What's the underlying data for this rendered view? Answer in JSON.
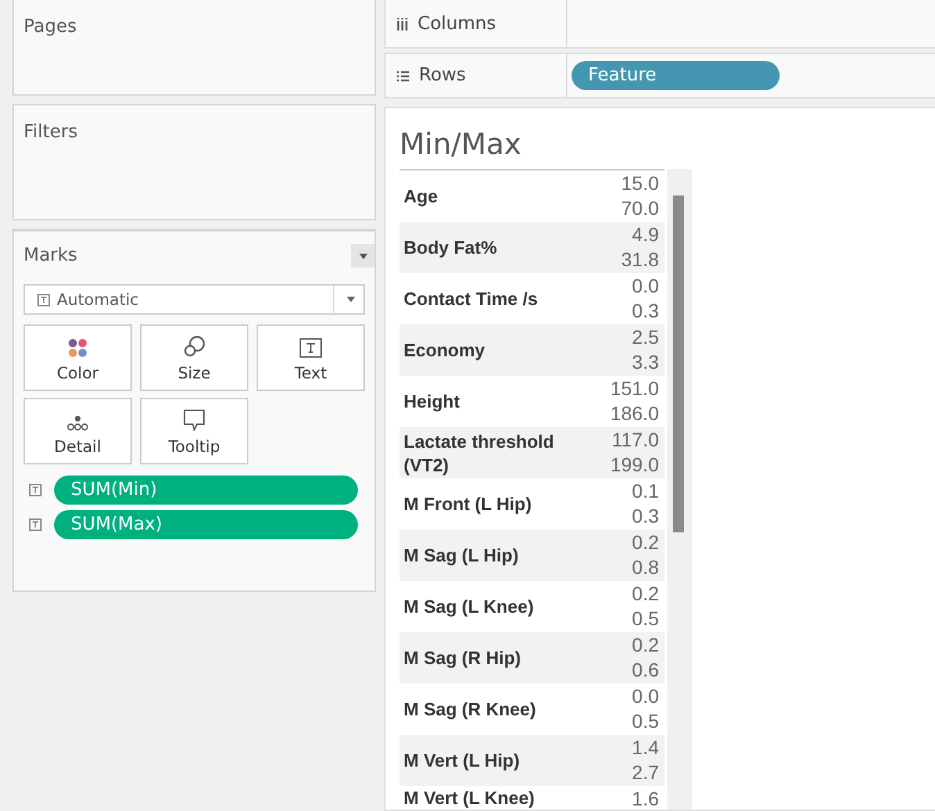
{
  "left_panel": {
    "pages": {
      "title": "Pages"
    },
    "filters": {
      "title": "Filters"
    },
    "marks": {
      "title": "Marks",
      "mark_type": "Automatic",
      "cards": [
        {
          "kind": "color",
          "label": "Color"
        },
        {
          "kind": "size",
          "label": "Size"
        },
        {
          "kind": "text",
          "label": "Text"
        },
        {
          "kind": "detail",
          "label": "Detail"
        },
        {
          "kind": "tooltip",
          "label": "Tooltip"
        }
      ],
      "pills": [
        {
          "label": "SUM(Min)"
        },
        {
          "label": "SUM(Max)"
        }
      ]
    }
  },
  "shelves": {
    "columns": {
      "label": "Columns"
    },
    "rows": {
      "label": "Rows",
      "pills": [
        {
          "label": "Feature"
        }
      ]
    }
  },
  "view": {
    "title": "Min/Max",
    "rows": [
      {
        "feature": "Age",
        "values": [
          "15.0",
          "70.0"
        ]
      },
      {
        "feature": "Body Fat%",
        "values": [
          "4.9",
          "31.8"
        ]
      },
      {
        "feature": "Contact Time /s",
        "values": [
          "0.0",
          "0.3"
        ]
      },
      {
        "feature": "Economy",
        "values": [
          "2.5",
          "3.3"
        ]
      },
      {
        "feature": "Height",
        "values": [
          "151.0",
          "186.0"
        ]
      },
      {
        "feature": "Lactate threshold (VT2)",
        "values": [
          "117.0",
          "199.0"
        ]
      },
      {
        "feature": "M Front (L Hip)",
        "values": [
          "0.1",
          "0.3"
        ]
      },
      {
        "feature": "M Sag (L Hip)",
        "values": [
          "0.2",
          "0.8"
        ]
      },
      {
        "feature": "M Sag (L Knee)",
        "values": [
          "0.2",
          "0.5"
        ]
      },
      {
        "feature": "M Sag (R Hip)",
        "values": [
          "0.2",
          "0.6"
        ]
      },
      {
        "feature": "M Sag (R Knee)",
        "values": [
          "0.0",
          "0.5"
        ]
      },
      {
        "feature": "M Vert (L Hip)",
        "values": [
          "1.4",
          "2.7"
        ]
      },
      {
        "feature": "M Vert (L Knee)",
        "values": [
          "1.6"
        ]
      }
    ]
  }
}
